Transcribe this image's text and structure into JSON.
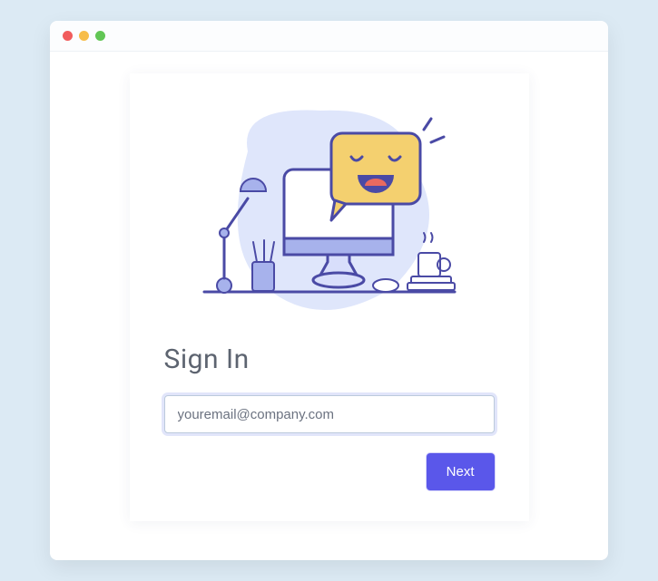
{
  "heading": "Sign In",
  "email": {
    "value": "youremail@company.com",
    "placeholder": "youremail@company.com"
  },
  "buttons": {
    "next": "Next"
  },
  "traffic_lights": [
    "red",
    "yellow",
    "green"
  ],
  "colors": {
    "accent": "#5a57ea",
    "page_bg": "#dceaf4"
  }
}
